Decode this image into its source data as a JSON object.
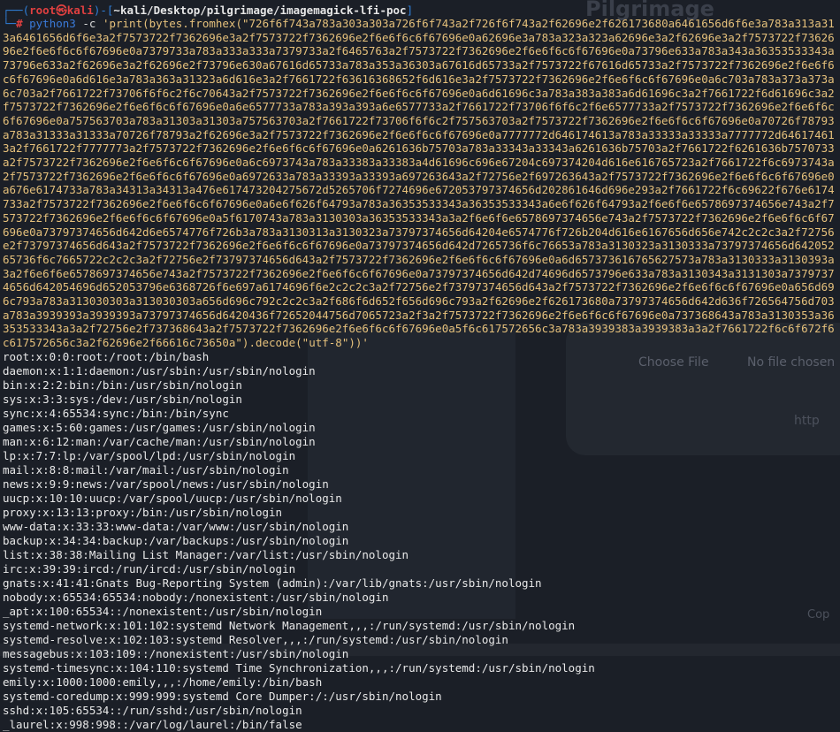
{
  "background": {
    "title": "Pilgrimage",
    "choose_file": "Choose File",
    "no_file": "No file chosen",
    "link": "http",
    "copyright": "Cop"
  },
  "prompt": {
    "user": "root",
    "at": "㉿",
    "host": "kali",
    "path": "~kali/Desktop/pilgrimage/imagemagick-lfi-poc",
    "hash": "#",
    "command": "python3",
    "option": "-c",
    "code_start": "'print(bytes.fromhex(\"",
    "hex": "726f6f743a783a303a303a726f6f743a2f726f6f743a2f62696e2f626173680a6461656d6f6e3a783a313a313a6461656d6f6e3a2f7573722f7362696e3a2f7573722f7362696e2f6e6f6c6f67696e0a62696e3a783a323a323a62696e3a2f62696e3a2f7573722f7362696e2f6e6f6c6f67696e0a7379733a783a333a333a7379733a2f6465763a2f7573722f7362696e2f6e6f6c6f67696e0a73796e633a783a343a36353533343a73796e633a2f62696e3a2f62696e2f73796e630a67616d65733a783a353a36303a67616d65733a2f7573722f67616d65733a2f7573722f7362696e2f6e6f6c6f67696e0a6d616e3a783a363a31323a6d616e3a2f7661722f63616368652f6d616e3a2f7573722f7362696e2f6e6f6c6f67696e0a6c703a783a373a373a6c703a2f7661722f73706f6f6c2f6c70643a2f7573722f7362696e2f6e6f6c6f67696e0a6d61696c3a783a383a383a6d61696c3a2f7661722f6d61696c3a2f7573722f7362696e2f6e6f6c6f67696e0a6e6577733a783a393a393a6e6577733a2f7661722f73706f6f6c2f6e6577733a2f7573722f7362696e2f6e6f6c6f67696e0a757563703a783a31303a31303a757563703a2f7661722f73706f6f6c2f757563703a2f7573722f7362696e2f6e6f6c6f67696e0a70726f78793a783a31333a31333a70726f78793a2f62696e3a2f7573722f7362696e2f6e6f6c6f67696e0a7777772d646174613a783a33333a33333a7777772d646174613a2f7661722f7777773a2f7573722f7362696e2f6e6f6c6f67696e0a6261636b75703a783a33343a33343a6261636b75703a2f7661722f6261636b7570733a2f7573722f7362696e2f6e6f6c6f67696e0a6c6973743a783a33383a33383a4d61696c696e67204c697374204d616e616765723a2f7661722f6c6973743a2f7573722f7362696e2f6e6f6c6f67696e0a6972633a783a33393a33393a697263643a2f72756e2f697263643a2f7573722f7362696e2f6e6f6c6f67696e0a676e6174733a783a34313a34313a476e617473204275672d5265706f7274696e672053797374656d202861646d696e293a2f7661722f6c69622f676e6174733a2f7573722f7362696e2f6e6f6c6f67696e0a6e6f626f64793a783a36353533343a36353533343a6e6f626f64793a2f6e6f6e6578697374656e743a2f7573722f7362696e2f6e6f6c6f67696e0a5f6170743a783a3130303a36353533343a3a2f6e6f6e6578697374656e743a2f7573722f7362696e2f6e6f6c6f67696e0a73797374656d642d6e6574776f726b3a783a3130313a3130323a73797374656d64204e6574776f726b204d616e6167656d656e742c2c2c3a2f72756e2f73797374656d643a2f7573722f7362696e2f6e6f6c6f67696e0a73797374656d642d7265736f6c76653a783a3130323a3130333a73797374656d64205265736f6c7665722c2c2c3a2f72756e2f73797374656d643a2f7573722f7362696e2f6e6f6c6f67696e0a6d657373616765627573a783a3130333a3130393a3a2f6e6f6e6578697374656e743a2f7573722f7362696e2f6e6f6c6f67696e0a73797374656d642d74696d6573796e633a783a3130343a3131303a73797374656d642054696d652053796e6368726f6e697a6174696f6e2c2c2c3a2f72756e2f73797374656d643a2f7573722f7362696e2f6e6f6c6f67696e0a656d696c793a783a313030303a313030303a656d696c792c2c2c3a2f686f6d652f656d696c793a2f62696e2f626173680a73797374656d642d636f726564756d703a783a3939393a3939393a73797374656d6420436f72652044756d7065723a2f3a2f7573722f7362696e2f6e6f6c6f67696e0a737368643a783a3130353a36353533343a3a2f72756e2f737368643a2f7573722f7362696e2f6e6f6c6f67696e0a5f6c617572656c3a783a3939383a3939383a3a2f7661722f6c6f672f6c617572656c3a2f62696e2f66616c73650a",
    "code_end": "\").decode(\"utf-8\"))'"
  },
  "output": [
    "root:x:0:0:root:/root:/bin/bash",
    "daemon:x:1:1:daemon:/usr/sbin:/usr/sbin/nologin",
    "bin:x:2:2:bin:/bin:/usr/sbin/nologin",
    "sys:x:3:3:sys:/dev:/usr/sbin/nologin",
    "sync:x:4:65534:sync:/bin:/bin/sync",
    "games:x:5:60:games:/usr/games:/usr/sbin/nologin",
    "man:x:6:12:man:/var/cache/man:/usr/sbin/nologin",
    "lp:x:7:7:lp:/var/spool/lpd:/usr/sbin/nologin",
    "mail:x:8:8:mail:/var/mail:/usr/sbin/nologin",
    "news:x:9:9:news:/var/spool/news:/usr/sbin/nologin",
    "uucp:x:10:10:uucp:/var/spool/uucp:/usr/sbin/nologin",
    "proxy:x:13:13:proxy:/bin:/usr/sbin/nologin",
    "www-data:x:33:33:www-data:/var/www:/usr/sbin/nologin",
    "backup:x:34:34:backup:/var/backups:/usr/sbin/nologin",
    "list:x:38:38:Mailing List Manager:/var/list:/usr/sbin/nologin",
    "irc:x:39:39:ircd:/run/ircd:/usr/sbin/nologin",
    "gnats:x:41:41:Gnats Bug-Reporting System (admin):/var/lib/gnats:/usr/sbin/nologin",
    "nobody:x:65534:65534:nobody:/nonexistent:/usr/sbin/nologin",
    "_apt:x:100:65534::/nonexistent:/usr/sbin/nologin",
    "systemd-network:x:101:102:systemd Network Management,,,:/run/systemd:/usr/sbin/nologin",
    "systemd-resolve:x:102:103:systemd Resolver,,,:/run/systemd:/usr/sbin/nologin",
    "messagebus:x:103:109::/nonexistent:/usr/sbin/nologin",
    "systemd-timesync:x:104:110:systemd Time Synchronization,,,:/run/systemd:/usr/sbin/nologin",
    "emily:x:1000:1000:emily,,,:/home/emily:/bin/bash",
    "systemd-coredump:x:999:999:systemd Core Dumper:/:/usr/sbin/nologin",
    "sshd:x:105:65534::/run/sshd:/usr/sbin/nologin",
    "_laurel:x:998:998::/var/log/laurel:/bin/false"
  ]
}
